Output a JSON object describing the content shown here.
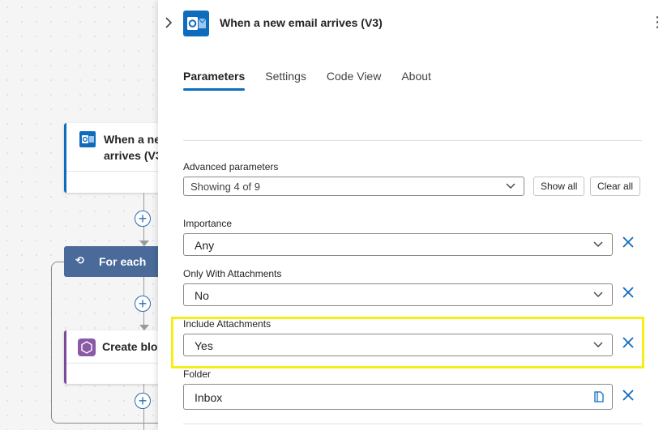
{
  "canvas": {
    "trigger_card_title_line1": "When a ne",
    "trigger_card_title_line2": "arrives (V3",
    "foreach_label": "For each",
    "create_blob_label": "Create blol"
  },
  "panel": {
    "title": "When a new email arrives (V3)",
    "tabs": [
      "Parameters",
      "Settings",
      "Code View",
      "About"
    ],
    "advanced": {
      "label": "Advanced parameters",
      "value": "Showing 4 of 9",
      "show_all": "Show all",
      "clear_all": "Clear all"
    },
    "fields": {
      "importance": {
        "label": "Importance",
        "value": "Any"
      },
      "only_attachments": {
        "label": "Only With Attachments",
        "value": "No"
      },
      "include_attachments": {
        "label": "Include Attachments",
        "value": "Yes"
      },
      "folder": {
        "label": "Folder",
        "value": "Inbox"
      }
    }
  },
  "colors": {
    "accent": "#0f6cbd",
    "highlight": "#f5ef15",
    "foreach": "#4a6a9a"
  },
  "icons": [
    "outlook-icon",
    "chevron-right-icon",
    "more-icon",
    "chevron-down-icon",
    "close-icon",
    "folder-picker-icon",
    "loop-icon",
    "blob-icon",
    "plus-icon"
  ]
}
